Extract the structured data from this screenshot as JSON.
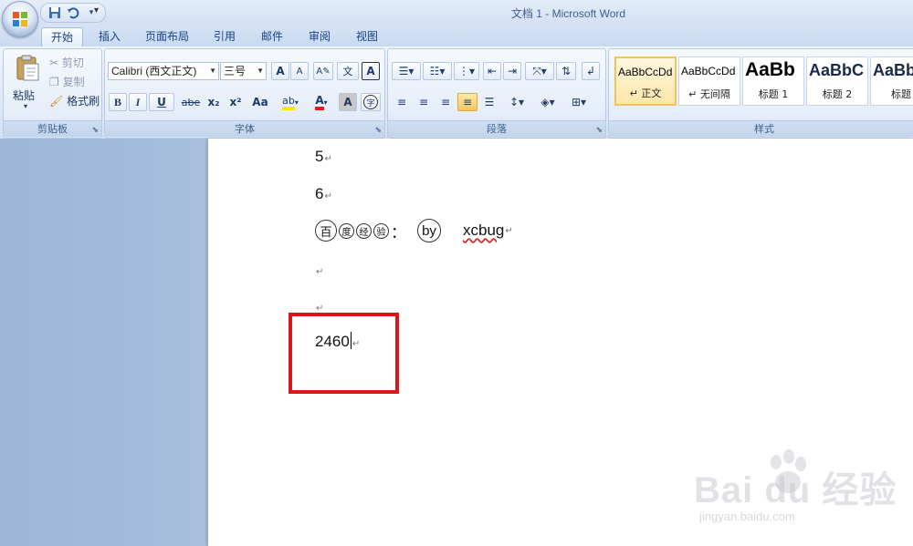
{
  "window": {
    "title": "文档 1 - Microsoft Word"
  },
  "tabs": [
    {
      "label": "开始",
      "active": true
    },
    {
      "label": "插入"
    },
    {
      "label": "页面布局"
    },
    {
      "label": "引用"
    },
    {
      "label": "邮件"
    },
    {
      "label": "审阅"
    },
    {
      "label": "视图"
    }
  ],
  "clipboard": {
    "paste": "粘贴",
    "cut": "剪切",
    "copy": "复制",
    "format_painter": "格式刷",
    "label": "剪贴板"
  },
  "font": {
    "name": "Calibri (西文正文)",
    "size": "三号",
    "label": "字体",
    "bold": "B",
    "italic": "I",
    "underline": "U",
    "strike": "abe",
    "subscript": "x₂",
    "superscript": "x²",
    "change_case": "Aa",
    "grow": "A",
    "shrink": "A",
    "font_color": "A",
    "char_shading": "A",
    "char_border": "A",
    "enclose": "字",
    "phonetic": "文"
  },
  "paragraph": {
    "label": "段落"
  },
  "styles": {
    "label": "样式",
    "items": [
      {
        "sample": "AaBbCcDd",
        "name": "↵ 正文",
        "selected": true
      },
      {
        "sample": "AaBbCcDd",
        "name": "↵ 无间隔"
      },
      {
        "sample": "AaBb",
        "name": "标题 1"
      },
      {
        "sample": "AaBbC",
        "name": "标题 2"
      },
      {
        "sample": "AaBb",
        "name": "标题"
      }
    ]
  },
  "document": {
    "line1": "5",
    "line2": "6",
    "enclosed_chars": [
      "百",
      "度",
      "经",
      "验"
    ],
    "colon": "：",
    "by": "by",
    "author": "xcbug",
    "typed_value": "2460"
  },
  "watermark": {
    "brand": "Bai du 经验",
    "url": "jingyan.baidu.com"
  },
  "colors": {
    "highlight": "#d81818",
    "ribbon": "#dfe9f6",
    "tab_text": "#15428b"
  }
}
